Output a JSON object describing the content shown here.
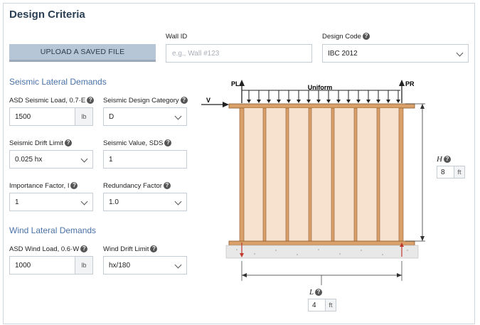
{
  "title": "Design Criteria",
  "upload_button": "UPLOAD A SAVED FILE",
  "wall_id": {
    "label": "Wall ID",
    "placeholder": "e.g., Wall #123"
  },
  "design_code": {
    "label": "Design Code",
    "value": "IBC 2012"
  },
  "seismic": {
    "heading": "Seismic Lateral Demands",
    "load": {
      "label": "ASD Seismic Load, 0.7·E",
      "value": "1500",
      "unit": "lb"
    },
    "category": {
      "label": "Seismic Design Category",
      "value": "D"
    },
    "drift": {
      "label": "Seismic Drift Limit",
      "value": "0.025 hx"
    },
    "value": {
      "label": "Seismic Value, SDS",
      "value": "1"
    },
    "importance": {
      "label": "Importance Factor, I",
      "value": "1"
    },
    "redundancy": {
      "label": "Redundancy Factor",
      "value": "1.0"
    }
  },
  "wind": {
    "heading": "Wind Lateral Demands",
    "load": {
      "label": "ASD Wind Load, 0.6·W",
      "value": "1000",
      "unit": "lb"
    },
    "drift": {
      "label": "Wind Drift Limit",
      "value": "hx/180"
    }
  },
  "diagram": {
    "pl": "PL",
    "pr": "PR",
    "uniform": "Uniform",
    "v": "V",
    "height": {
      "label": "H",
      "value": "8",
      "unit": "ft"
    },
    "length": {
      "label": "L",
      "value": "4",
      "unit": "ft"
    }
  },
  "colors": {
    "accent": "#4a72a8",
    "title": "#2b4055",
    "button": "#b7c6d6",
    "stud": "#d9a06a",
    "sheathing": "#f7e2cf"
  }
}
